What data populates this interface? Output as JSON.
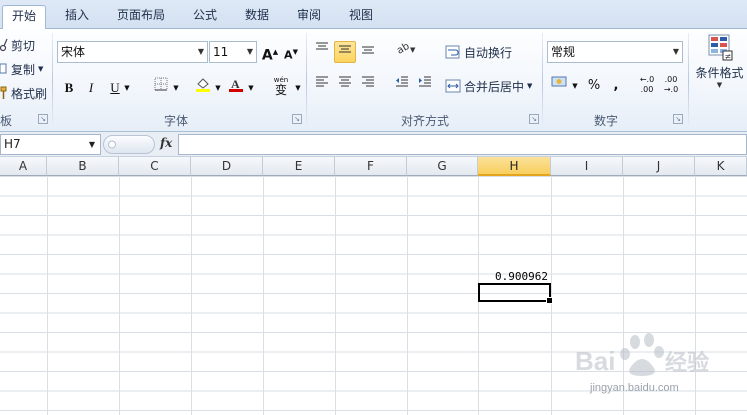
{
  "tabs": [
    {
      "label": "开始",
      "active": true
    },
    {
      "label": "插入"
    },
    {
      "label": "页面布局"
    },
    {
      "label": "公式"
    },
    {
      "label": "数据"
    },
    {
      "label": "审阅"
    },
    {
      "label": "视图"
    }
  ],
  "clipboard": {
    "cut_label": "剪切",
    "copy_label": "复制",
    "format_painter_label": "格式刷",
    "group_label": "板"
  },
  "font": {
    "name": "宋体",
    "size": "11",
    "bold": "B",
    "italic": "I",
    "underline": "U",
    "grow": "A",
    "shrink": "A",
    "phonetic": "wén",
    "phonetic_char": "变",
    "group_label": "字体"
  },
  "alignment": {
    "wrap_label": "自动换行",
    "merge_label": "合并后居中",
    "group_label": "对齐方式"
  },
  "number": {
    "format": "常规",
    "percent": "%",
    "comma": ",",
    "inc_decimal_top": "←.0",
    "inc_decimal_bottom": ".00",
    "dec_decimal_top": ".00",
    "dec_decimal_bottom": "→.0",
    "group_label": "数字"
  },
  "styles": {
    "conditional_label": "条件格式"
  },
  "formula_bar": {
    "name_box": "H7",
    "fx": "fx",
    "value": ""
  },
  "columns": [
    "A",
    "B",
    "C",
    "D",
    "E",
    "F",
    "G",
    "H",
    "I",
    "J",
    "K"
  ],
  "active_column": "H",
  "cell": {
    "address": "H6",
    "value": "0.900962"
  },
  "watermark": {
    "brand": "Baidu经验",
    "url": "jingyan.baidu.com"
  },
  "colors": {
    "accent_selected": "#fbd35e",
    "font_color_bar": "#d40000",
    "fill_color_bar": "#ffff00"
  }
}
